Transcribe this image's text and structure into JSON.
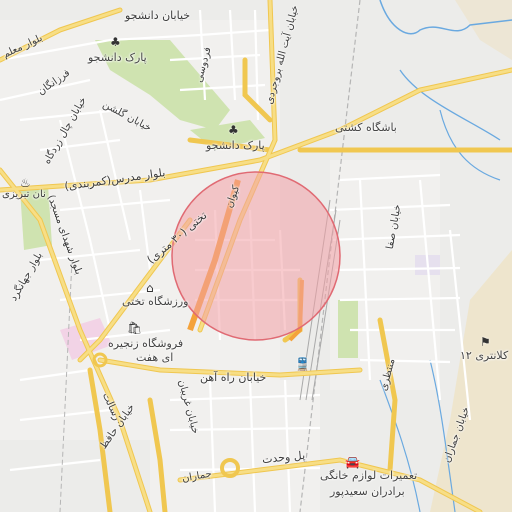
{
  "map": {
    "colors": {
      "background": "#ececea",
      "major_road": "#f4d36b",
      "minor_road": "#ffffff",
      "park": "#cfe3b0",
      "water": "#6aa9e0",
      "railway": "#a9a9a9",
      "highlight_fill": "#f3a1a6",
      "highlight_stroke": "#e06a73",
      "pink_area": "#f2d3e6",
      "sand": "#efe3c6"
    },
    "labels": {
      "blvd_moalem": "بلوار معلم",
      "khiaban_daneshjoo": "خیابان دانشجو",
      "park_daneshjoo_top": "پارک دانشجو",
      "farzanegan": "فرزانگان",
      "ferdowsi": "فردوسی",
      "ayatollah_boroujerdi": "خیابان آیت الله بروجردی",
      "khiaban_golshan": "خیابان گلشن",
      "chal_zardgah": "خیابان چال زردگاه",
      "park_daneshjoo": "پارک دانشجو",
      "bashgah_koshti": "باشگاه کشتی",
      "blvd_modarres": "(بلوار مدرس(کمربندی",
      "tabrizi": "نان تبریزی",
      "keyvan": "کیوان",
      "takhti_30": "(تختی (۳۰ متری",
      "shohada_masjed": "(بلوار شهدای مسجد",
      "jahangard": "بلوار جهانگرد",
      "varzeshgah": "ورزشگاه تختی",
      "safa": "خیابان صفا",
      "forushgah": "فروشگاه زنجیره",
      "forushgah2": "ای هفت",
      "rahahan": "خیابان راه آهن",
      "montazeri": "منتظری",
      "kalantari": "کلانتری ۱۲",
      "hafez": "خیابان حافظ",
      "ghariban": "خیابان غریبان",
      "resalat": "رسالت",
      "pol_vahdat": "پل وحدت",
      "jamaran": "جماران",
      "jamaran_east": "خیابان جماران",
      "tamirat1": "تعمیرات لوازم خانگی",
      "tamirat2": "برادران سعیدپور"
    },
    "icons": {
      "park_top": "tree-icon",
      "park_mid": "tree-icon",
      "bakery": "bakery-icon",
      "stadium": "stadium-icon",
      "shop": "shopping-bag-icon",
      "train": "train-station-icon",
      "repair": "car-repair-icon",
      "police": "police-icon"
    }
  }
}
